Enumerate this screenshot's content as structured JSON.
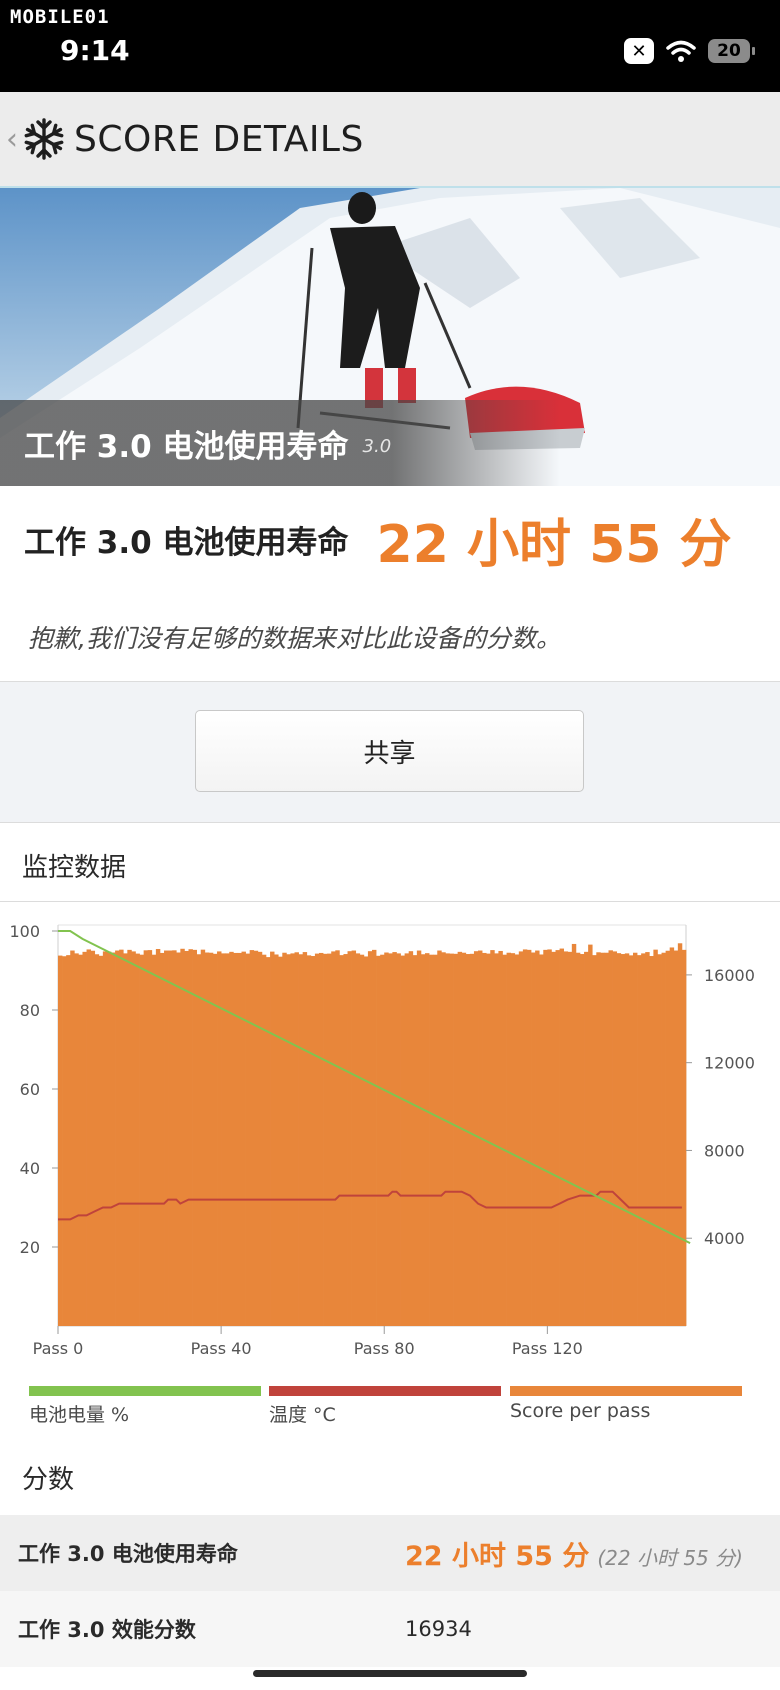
{
  "status_bar": {
    "watermark": "MOBILE01",
    "time": "9:14",
    "battery": "20",
    "x_badge": "✕"
  },
  "header": {
    "title": "SCORE DETAILS",
    "back_icon": "chevron-left-icon",
    "logo_icon": "snowflake-icon"
  },
  "hero": {
    "title": "工作 3.0 电池使用寿命",
    "version": "3.0"
  },
  "result": {
    "label": "工作 3.0 电池使用寿命",
    "value": "22 小时 55 分"
  },
  "notice": "抱歉,我们没有足够的数据来对比此设备的分数。",
  "share_button": "共享",
  "monitoring": {
    "title": "监控数据",
    "legend": [
      {
        "label": "电池电量 %",
        "color": "#82c34f"
      },
      {
        "label": "温度 °C",
        "color": "#c0433b"
      },
      {
        "label": "Score per pass",
        "color": "#e8863a"
      }
    ]
  },
  "scores": {
    "title": "分数",
    "rows": [
      {
        "label": "工作 3.0 电池使用寿命",
        "value": "22 小时 55 分",
        "sub": "(22 小时 55 分)"
      },
      {
        "label": "工作 3.0 效能分数",
        "value": "16934"
      }
    ]
  },
  "chart_data": {
    "type": "bar",
    "x_label_prefix": "Pass",
    "x_ticks": [
      0,
      40,
      80,
      120
    ],
    "x_range": [
      0,
      154
    ],
    "left_axis": {
      "ticks": [
        20,
        40,
        60,
        80,
        100
      ],
      "range": [
        0,
        100
      ]
    },
    "right_axis": {
      "ticks": [
        "4000",
        "8000",
        "12000",
        "16000"
      ],
      "range": [
        0,
        18000
      ]
    },
    "series": [
      {
        "name": "Score per pass",
        "axis": "right",
        "count": 154,
        "values": [
          16880,
          16850,
          16900,
          17110,
          16980,
          16920,
          17050,
          17160,
          17100,
          16940,
          16870,
          17070,
          17060,
          17020,
          17110,
          17150,
          16980,
          17140,
          17070,
          16970,
          16920,
          17120,
          17130,
          16920,
          17180,
          17000,
          17110,
          17110,
          17120,
          17020,
          17190,
          17090,
          17170,
          17140,
          16940,
          17150,
          17020,
          17010,
          16960,
          17070,
          16980,
          16980,
          17050,
          17000,
          17000,
          17060,
          16970,
          17130,
          17100,
          17050,
          16920,
          16810,
          17060,
          16930,
          16830,
          17010,
          16940,
          16980,
          17030,
          16940,
          17040,
          16890,
          16860,
          16970,
          17000,
          16960,
          16970,
          17070,
          17120,
          16900,
          16950,
          17080,
          17110,
          16980,
          16920,
          16840,
          17080,
          17140,
          16870,
          16920,
          17020,
          16980,
          17040,
          16980,
          16880,
          16980,
          17080,
          16900,
          17110,
          16940,
          16990,
          16920,
          16920,
          17110,
          17030,
          16980,
          16970,
          16960,
          17050,
          17010,
          16950,
          16960,
          17080,
          17110,
          17000,
          16970,
          17130,
          16980,
          17090,
          16920,
          17010,
          16990,
          16930,
          17070,
          17160,
          17140,
          17020,
          17110,
          16930,
          17140,
          17160,
          17050,
          17130,
          17200,
          17070,
          17050,
          17410,
          17010,
          16950,
          17050,
          17380,
          16900,
          17030,
          17010,
          17010,
          17120,
          17070,
          16990,
          16950,
          16980,
          16890,
          17010,
          16900,
          16980,
          17040,
          16860,
          17150,
          16940,
          17010,
          17100,
          17250,
          17110,
          17440,
          17140,
          16920,
          17240,
          17270,
          16640
        ]
      },
      {
        "name": "电池电量 %",
        "axis": "left",
        "points": [
          [
            0,
            100
          ],
          [
            3,
            100
          ],
          [
            6,
            98
          ],
          [
            155,
            21
          ]
        ]
      },
      {
        "name": "温度 °C",
        "axis": "left",
        "points": [
          [
            0,
            27
          ],
          [
            3,
            27
          ],
          [
            5,
            28
          ],
          [
            7,
            28
          ],
          [
            9,
            29
          ],
          [
            11,
            30
          ],
          [
            13,
            30
          ],
          [
            15,
            31
          ],
          [
            26,
            31
          ],
          [
            27,
            32
          ],
          [
            29,
            32
          ],
          [
            30,
            31
          ],
          [
            32,
            32
          ],
          [
            68,
            32
          ],
          [
            69,
            33
          ],
          [
            81,
            33
          ],
          [
            82,
            34
          ],
          [
            83,
            34
          ],
          [
            84,
            33
          ],
          [
            94,
            33
          ],
          [
            95,
            34
          ],
          [
            99,
            34
          ],
          [
            101,
            33
          ],
          [
            103,
            31
          ],
          [
            105,
            30
          ],
          [
            121,
            30
          ],
          [
            123,
            31
          ],
          [
            125,
            32
          ],
          [
            128,
            33
          ],
          [
            132,
            33
          ],
          [
            133,
            34
          ],
          [
            136,
            34
          ],
          [
            138,
            32
          ],
          [
            140,
            30
          ],
          [
            153,
            30
          ]
        ]
      }
    ]
  }
}
